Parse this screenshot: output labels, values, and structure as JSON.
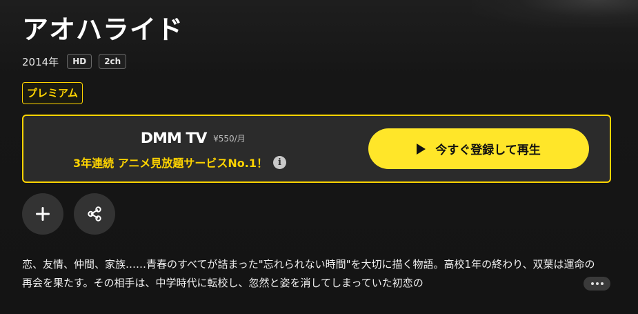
{
  "show": {
    "title": "アオハライド",
    "year": "2014年",
    "tags": [
      "HD",
      "2ch"
    ],
    "plan_badge": "プレミアム"
  },
  "promo": {
    "logo_text": "DMM TV",
    "price": "¥550/月",
    "tagline": "3年連続 アニメ見放題サービスNo.1！",
    "info_icon": "info-icon",
    "cta_label": "今すぐ登録して再生",
    "accent_color": "#ffd400",
    "cta_color": "#ffe629"
  },
  "actions": {
    "add_icon": "plus-icon",
    "share_icon": "share-icon"
  },
  "description": {
    "text": "恋、友情、仲間、家族……青春のすべてが詰まった\"忘れられない時間\"を大切に描く物語。高校1年の終わり、双葉は運命の再会を果たす。その相手は、中学時代に転校し、忽然と姿を消してしまっていた初恋の",
    "more_icon": "ellipsis-icon"
  }
}
